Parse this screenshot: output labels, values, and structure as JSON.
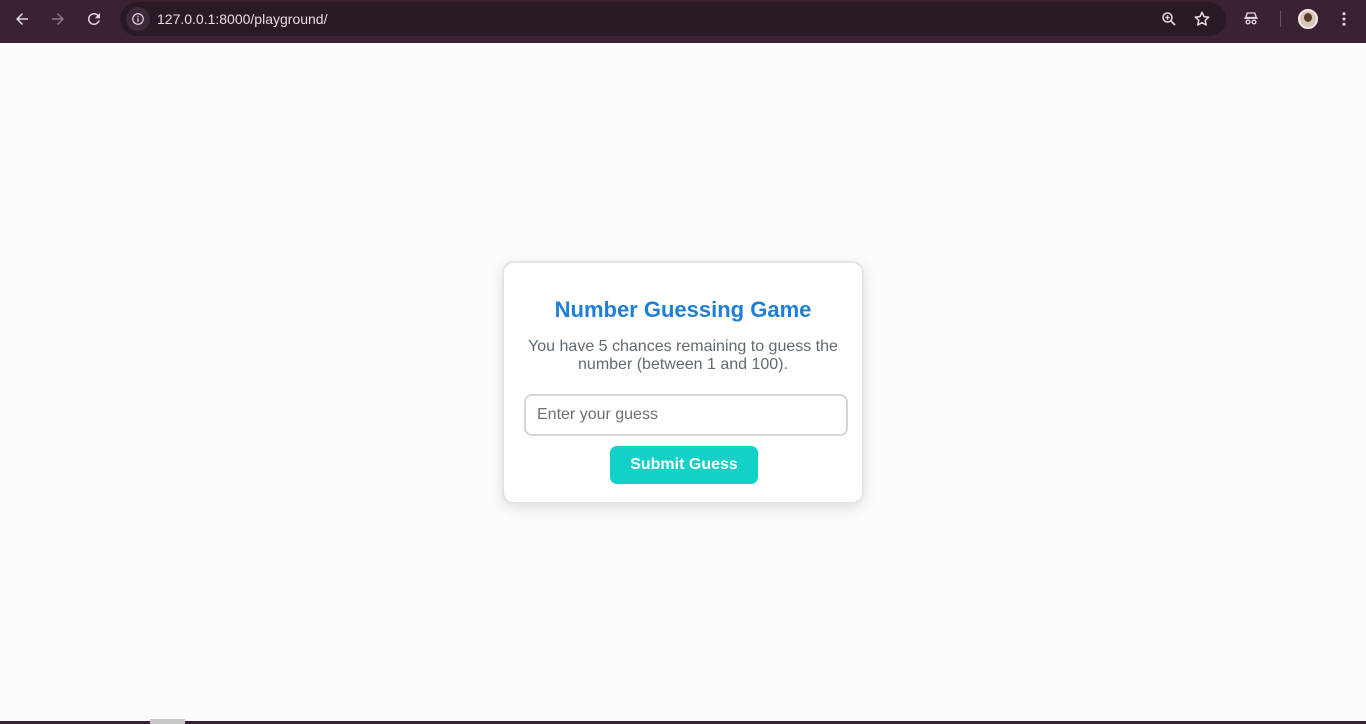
{
  "browser": {
    "url": "127.0.0.1:8000/playground/",
    "colors": {
      "toolbar": "#3a2233",
      "omnibox": "#2a1a26"
    }
  },
  "game": {
    "title": "Number Guessing Game",
    "description": "You have 5 chances remaining to guess the number (between 1 and 100).",
    "input_placeholder": "Enter your guess",
    "input_value": "",
    "submit_label": "Submit Guess",
    "colors": {
      "title": "#1e7fd6",
      "button": "#12d1c6",
      "text": "#5f6b72"
    }
  }
}
